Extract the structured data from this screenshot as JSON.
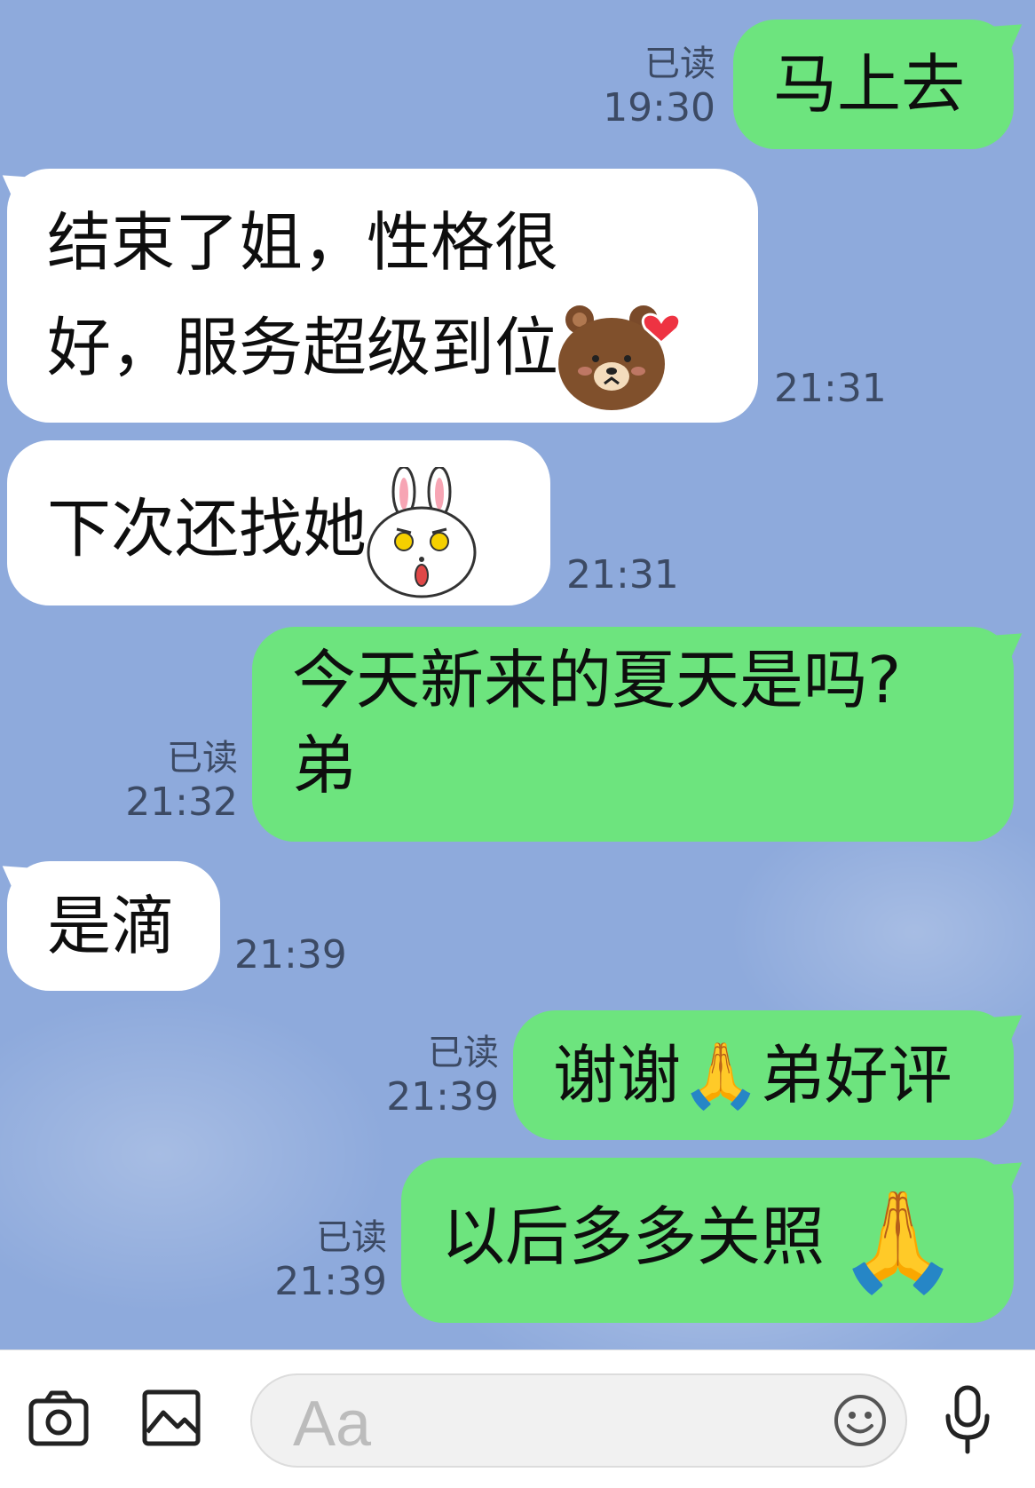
{
  "messages": [
    {
      "id": "m1",
      "dir": "out",
      "lines": [
        "马上去"
      ],
      "read": "已读",
      "time": "19:30"
    },
    {
      "id": "m2",
      "dir": "in",
      "lines": [
        "结束了姐，性格很",
        "好，服务超级到位"
      ],
      "sticker": "bear-heart-sticker",
      "time": "21:31"
    },
    {
      "id": "m3",
      "dir": "in",
      "lines": [
        "下次还找她"
      ],
      "sticker": "bunny-sticker",
      "time": "21:31"
    },
    {
      "id": "m4",
      "dir": "out",
      "lines": [
        "今天新来的夏天是吗?",
        "弟"
      ],
      "read": "已读",
      "time": "21:32"
    },
    {
      "id": "m5",
      "dir": "in",
      "lines": [
        "是滴"
      ],
      "time": "21:39"
    },
    {
      "id": "m6",
      "dir": "out",
      "lines": [
        "谢谢🙏弟好评"
      ],
      "read": "已读",
      "time": "21:39"
    },
    {
      "id": "m7",
      "dir": "out",
      "lines": [
        "以后多多关照"
      ],
      "emoji": "🙏",
      "read": "已读",
      "time": "21:39"
    }
  ],
  "input_bar": {
    "placeholder": "Aa",
    "icons": [
      "camera-icon",
      "image-icon",
      "emoji-icon",
      "microphone-icon"
    ]
  },
  "colors": {
    "background": "#8eaadc",
    "outgoing": "#6de47e",
    "incoming": "#ffffff"
  }
}
